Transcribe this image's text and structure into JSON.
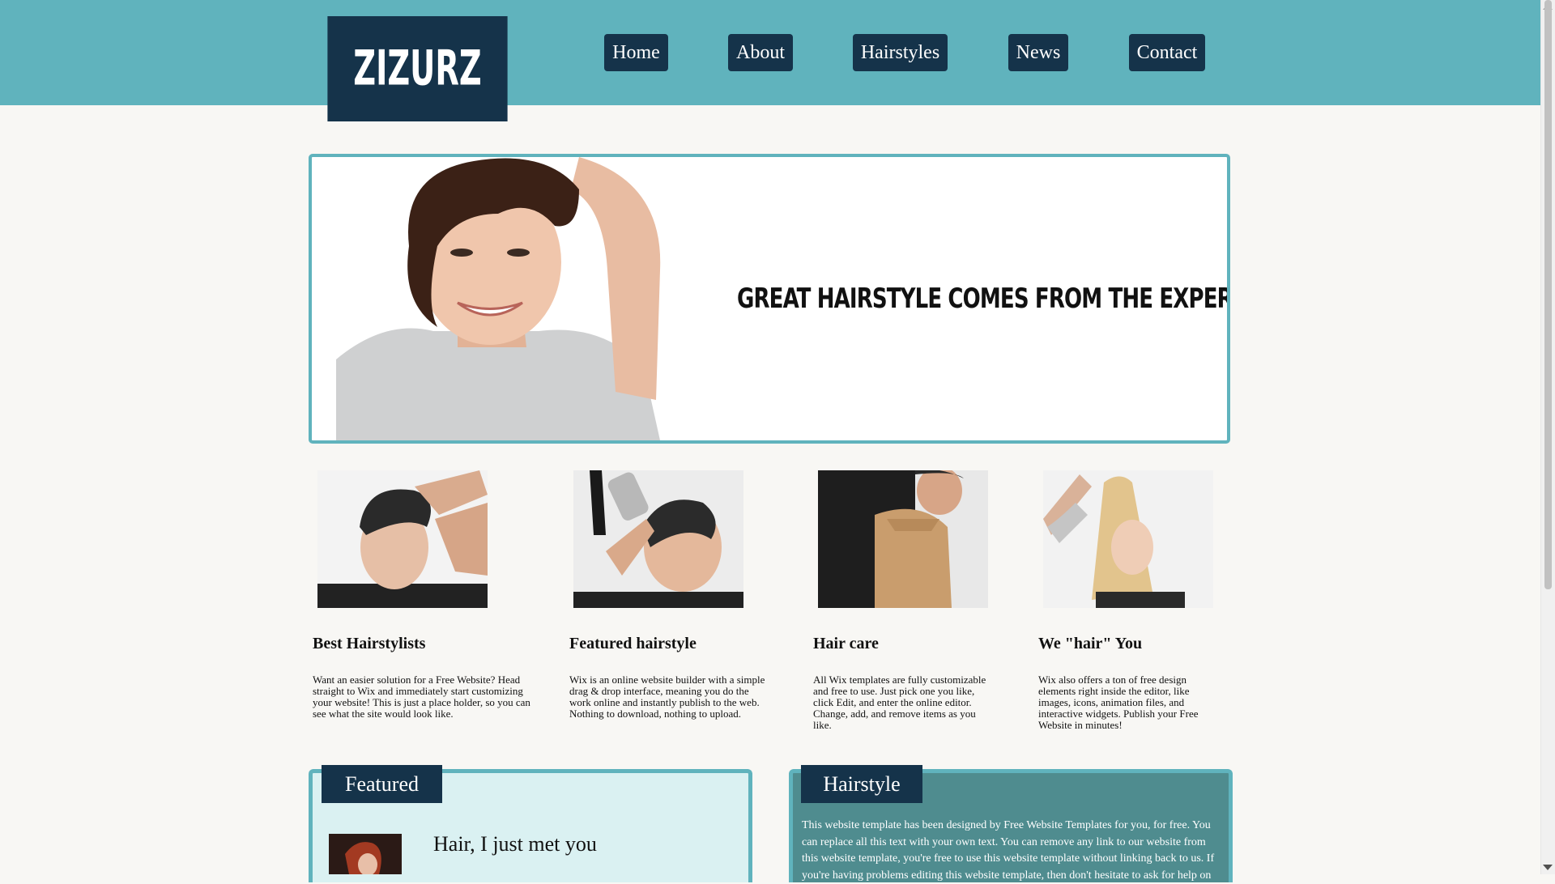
{
  "site": {
    "logo": "ZIZURZ"
  },
  "nav": [
    {
      "label": "Home"
    },
    {
      "label": "About"
    },
    {
      "label": "Hairstyles"
    },
    {
      "label": "News"
    },
    {
      "label": "Contact"
    }
  ],
  "hero": {
    "title": "Great Hairstyle Comes From The Experts"
  },
  "features": [
    {
      "title": "Best Hairstylists",
      "text": "Want an easier solution for a Free Website? Head straight to Wix and immediately start customizing your website! This is just a place holder, so you can see what the site would look like."
    },
    {
      "title": "Featured hairstyle",
      "text": "Wix is an online website builder with a simple drag & drop interface, meaning you do the work online and instantly publish to the web. Nothing to download, nothing to upload."
    },
    {
      "title": "Hair care",
      "text": "All Wix templates are fully customizable and free to use. Just pick one you like, click Edit, and enter the online editor. Change, add, and remove items as you like."
    },
    {
      "title": "We \"hair\" You",
      "text": "Wix also offers a ton of free design elements right inside the editor, like images, icons, animation files, and interactive widgets. Publish your Free Website in minutes!"
    }
  ],
  "featured_panel": {
    "tab": "Featured",
    "item_title": "Hair, I just met you"
  },
  "hairstyle_panel": {
    "tab": "Hairstyle",
    "text": "This website template has been designed by Free Website Templates for you, for free. You can replace all this text with your own text. You can remove any link to our website from this website template, you're free to use this website template without linking back to us. If you're having problems editing this website template, then don't hesitate to ask for help on"
  },
  "colors": {
    "header_teal": "#60b3bd",
    "navy": "#15334a",
    "page_bg": "#f8f7f4",
    "featured_bg": "#daf1f2",
    "hairstyle_bg": "#4f8c8f"
  }
}
